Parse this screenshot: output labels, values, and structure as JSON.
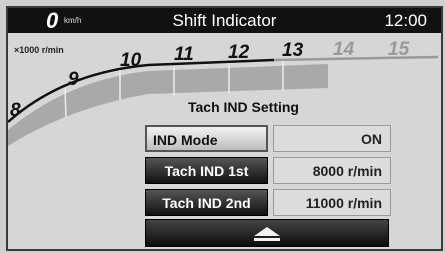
{
  "header": {
    "speed_value": "0",
    "speed_unit": "km/h",
    "title": "Shift Indicator",
    "clock": "12:00"
  },
  "tach": {
    "unit_label": "×1000 r/min",
    "numbers": [
      "8",
      "9",
      "10",
      "11",
      "12",
      "13",
      "14",
      "15"
    ],
    "colors": {
      "active": "#111111",
      "inactive": "#9a9a9a",
      "band": "#a8a8a8"
    }
  },
  "settings": {
    "heading": "Tach IND Setting",
    "rows": [
      {
        "label": "IND Mode",
        "value": "ON"
      },
      {
        "label": "Tach IND 1st",
        "value": "8000  r/min"
      },
      {
        "label": "Tach IND 2nd",
        "value": "11000  r/min"
      }
    ]
  },
  "nav": {
    "back_icon": "eject-up-icon"
  }
}
